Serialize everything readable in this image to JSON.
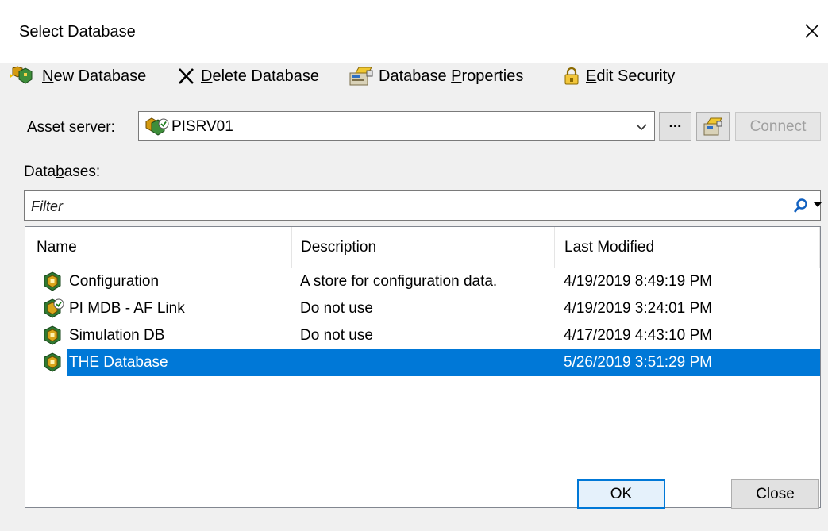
{
  "window": {
    "title": "Select Database"
  },
  "toolbar": {
    "new_db": {
      "accel": "N",
      "rest": "ew Database"
    },
    "delete_db": {
      "accel": "D",
      "rest": "elete Database"
    },
    "db_props": {
      "pre": "Database ",
      "accel": "P",
      "rest": "roperties"
    },
    "edit_security": {
      "accel": "E",
      "rest": "dit Security"
    }
  },
  "asset_server": {
    "label_pre": "Asset ",
    "label_accel": "s",
    "label_post": "erver:",
    "value": "PISRV01",
    "browse_label": "···",
    "connect_label": "Connect"
  },
  "databases": {
    "label_pre": "Data",
    "label_accel": "b",
    "label_post": "ases:",
    "filter_placeholder": "Filter",
    "columns": [
      "Name",
      "Description",
      "Last Modified"
    ],
    "rows": [
      {
        "name": "Configuration",
        "description": "A store for configuration data.",
        "modified": "4/19/2019 8:49:19 PM",
        "selected": false
      },
      {
        "name": "PI MDB - AF Link",
        "description": "Do not use",
        "modified": "4/19/2019 3:24:01 PM",
        "selected": false
      },
      {
        "name": "Simulation DB",
        "description": "Do not use",
        "modified": "4/17/2019 4:43:10 PM",
        "selected": false
      },
      {
        "name": "THE Database",
        "description": "",
        "modified": "5/26/2019 3:51:29 PM",
        "selected": true
      }
    ]
  },
  "buttons": {
    "ok": "OK",
    "close": "Close"
  },
  "colors": {
    "selection": "#0078d7",
    "dialog_bg": "#f0f0f0",
    "default_button_border": "#0078d7"
  }
}
